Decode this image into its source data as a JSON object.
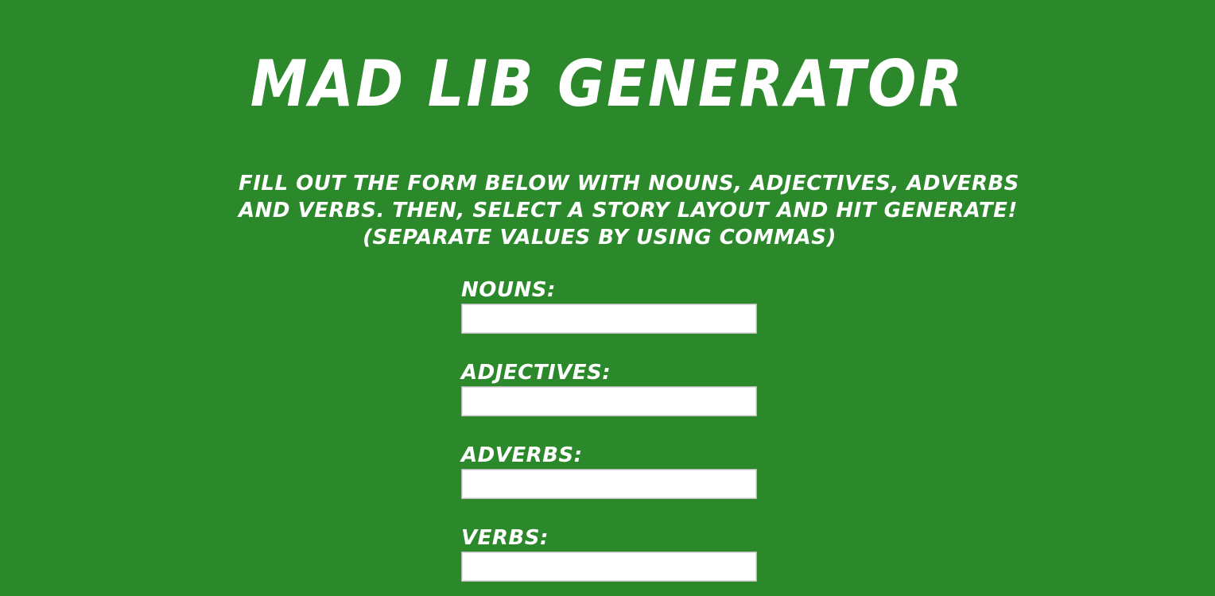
{
  "header": {
    "title": "Mad Lib Generator"
  },
  "instructions": {
    "line1": "Fill out the form below with nouns, adjectives, adverbs",
    "line2": "and verbs. Then, select a story layout and hit generate!",
    "line3": "(Separate values by using commas)"
  },
  "form": {
    "nouns": {
      "label": "Nouns:",
      "value": "",
      "placeholder": ""
    },
    "adjectives": {
      "label": "Adjectives:",
      "value": "",
      "placeholder": ""
    },
    "adverbs": {
      "label": "Adverbs:",
      "value": "",
      "placeholder": ""
    },
    "verbs": {
      "label": "Verbs:",
      "value": "",
      "placeholder": ""
    }
  },
  "colors": {
    "background": "#2b892b",
    "text": "#ffffff",
    "input_background": "#ffffff"
  }
}
